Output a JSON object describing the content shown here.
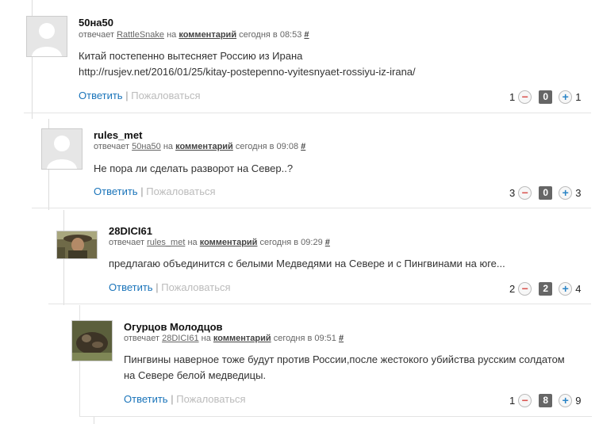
{
  "comments": [
    {
      "author": "50на50",
      "reply_prefix": "отвечает",
      "reply_to": "RattleSnake",
      "on": "на",
      "comment_link": "комментарий",
      "time": "сегодня в 08:53",
      "anchor": "#",
      "text_lines": [
        "Китай постепенно вытесняет Россию из Ирана",
        "http://rusjev.net/2016/01/25/kitay-postepenno-vyitesnyaet-rossiyu-iz-irana/"
      ],
      "reply_label": "Ответить",
      "separator": "|",
      "report_label": "Пожаловаться",
      "votes_down": "1",
      "score": "0",
      "votes_up": "1"
    },
    {
      "author": "rules_met",
      "reply_prefix": "отвечает",
      "reply_to": "50на50",
      "on": "на",
      "comment_link": "комментарий",
      "time": "сегодня в 09:08",
      "anchor": "#",
      "text_lines": [
        "Не пора ли сделать разворот на Север..?"
      ],
      "reply_label": "Ответить",
      "separator": "|",
      "report_label": "Пожаловаться",
      "votes_down": "3",
      "score": "0",
      "votes_up": "3"
    },
    {
      "author": "28DICI61",
      "reply_prefix": "отвечает",
      "reply_to": "rules_met",
      "on": "на",
      "comment_link": "комментарий",
      "time": "сегодня в 09:29",
      "anchor": "#",
      "text_lines": [
        "предлагаю объединится с белыми Медведями на Севере и с Пингвинами на юге..."
      ],
      "reply_label": "Ответить",
      "separator": "|",
      "report_label": "Пожаловаться",
      "votes_down": "2",
      "score": "2",
      "votes_up": "4"
    },
    {
      "author": "Огурцов Молодцов",
      "reply_prefix": "отвечает",
      "reply_to": "28DICI61",
      "on": "на",
      "comment_link": "комментарий",
      "time": "сегодня в 09:51",
      "anchor": "#",
      "text_lines": [
        "Пингвины наверное тоже будут против России,после жестокого убийства русским солдатом",
        "на Севере белой медведицы."
      ],
      "reply_label": "Ответить",
      "separator": "|",
      "report_label": "Пожаловаться",
      "votes_down": "1",
      "score": "8",
      "votes_up": "9"
    }
  ],
  "icons": {
    "minus": "−",
    "plus": "+"
  },
  "colors": {
    "link": "#1a74ba",
    "minus": "#d9534f",
    "plus": "#2a84c6",
    "score_bg": "#666666"
  }
}
